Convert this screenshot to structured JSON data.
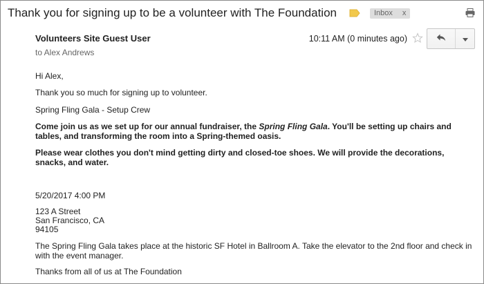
{
  "subject": "Thank you for signing up to be a volunteer with The Foundation",
  "label_chip": {
    "text": "Inbox",
    "close": "x"
  },
  "colors": {
    "label_tag": "#f2c94c",
    "chip_bg": "#dddddd"
  },
  "icons": {
    "label": "label-tag-icon",
    "print": "print-icon",
    "star": "star-icon",
    "reply": "reply-icon",
    "more": "chevron-down-icon"
  },
  "message": {
    "sender": "Volunteers Site Guest User",
    "to": "to Alex Andrews",
    "time": "10:11 AM (0 minutes ago)"
  },
  "body": {
    "greeting": "Hi Alex,",
    "thanks": "Thank you so much for signing up to volunteer.",
    "event": "Spring Fling Gala - Setup Crew",
    "para1_before": "Come join us as we set up for our annual fundraiser, the ",
    "para1_emph": "Spring Fling Gala",
    "para1_after": ". You'll be setting up chairs and tables, and transforming the room into a Spring-themed oasis.",
    "para2": "Please wear clothes you don't mind getting dirty and closed-toe shoes. We will provide the decorations, snacks, and water.",
    "datetime": "5/20/2017 4:00 PM",
    "address": [
      "123 A Street",
      "San Francisco, CA",
      "94105"
    ],
    "details": "The Spring Fling Gala takes place at the historic SF Hotel in Ballroom A. Take the elevator to the 2nd floor and check in with the event manager.",
    "closing": "Thanks from all of us at The Foundation"
  }
}
